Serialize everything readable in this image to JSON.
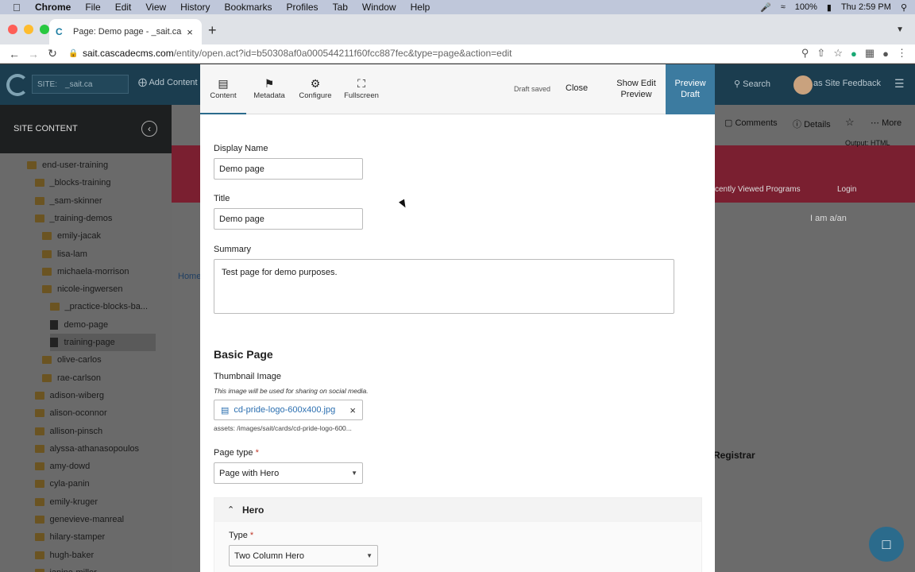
{
  "mac_menu": {
    "app": "Chrome",
    "items": [
      "File",
      "Edit",
      "View",
      "History",
      "Bookmarks",
      "Profiles",
      "Tab",
      "Window",
      "Help"
    ],
    "battery": "100%",
    "clock": "Thu 2:59 PM"
  },
  "browser": {
    "tab_title": "Page: Demo page - _sait.ca | C",
    "url_host": "sait.cascadecms.com",
    "url_path": "/entity/open.act?id=b50308af0a000544211f60fcc887fec&type=page&action=edit"
  },
  "cms": {
    "site_label": "SITE:",
    "site_value": "_sait.ca",
    "add_content": "Add Content",
    "search": "Search",
    "site_feedback": "as Site Feedback",
    "sidebar_title": "SITE CONTENT",
    "tree": [
      {
        "label": "end-user-training",
        "type": "folder",
        "indent": 1
      },
      {
        "label": "_blocks-training",
        "type": "folder",
        "indent": 2
      },
      {
        "label": "_sam-skinner",
        "type": "folder",
        "indent": 2
      },
      {
        "label": "_training-demos",
        "type": "folder",
        "indent": 2
      },
      {
        "label": "emily-jacak",
        "type": "folder",
        "indent": 3
      },
      {
        "label": "lisa-lam",
        "type": "folder",
        "indent": 3
      },
      {
        "label": "michaela-morrison",
        "type": "folder",
        "indent": 3
      },
      {
        "label": "nicole-ingwersen",
        "type": "folder",
        "indent": 3
      },
      {
        "label": "_practice-blocks-ba...",
        "type": "folder",
        "indent": 4
      },
      {
        "label": "demo-page",
        "type": "page",
        "indent": 4
      },
      {
        "label": "training-page",
        "type": "page",
        "indent": 4,
        "selected": true
      },
      {
        "label": "olive-carlos",
        "type": "folder",
        "indent": 3
      },
      {
        "label": "rae-carlson",
        "type": "folder",
        "indent": 3
      },
      {
        "label": "adison-wiberg",
        "type": "folder",
        "indent": 2
      },
      {
        "label": "alison-oconnor",
        "type": "folder",
        "indent": 2
      },
      {
        "label": "allison-pinsch",
        "type": "folder",
        "indent": 2
      },
      {
        "label": "alyssa-athanasopoulos",
        "type": "folder",
        "indent": 2
      },
      {
        "label": "amy-dowd",
        "type": "folder",
        "indent": 2
      },
      {
        "label": "cyla-panin",
        "type": "folder",
        "indent": 2
      },
      {
        "label": "emily-kruger",
        "type": "folder",
        "indent": 2
      },
      {
        "label": "genevieve-manreal",
        "type": "folder",
        "indent": 2
      },
      {
        "label": "hilary-stamper",
        "type": "folder",
        "indent": 2
      },
      {
        "label": "hugh-baker",
        "type": "folder",
        "indent": 2
      },
      {
        "label": "janine-miller",
        "type": "folder",
        "indent": 2
      }
    ],
    "bg": {
      "comments": "Comments",
      "details": "Details",
      "more": "More",
      "output": "Output: HTML",
      "recently_viewed": "cently Viewed Programs",
      "login": "Login",
      "i_am": "I am a/an",
      "home": "Home",
      "registrar": "Registrar"
    }
  },
  "editor": {
    "tabs": [
      {
        "label": "Content",
        "icon": "document-icon"
      },
      {
        "label": "Metadata",
        "icon": "tag-icon"
      },
      {
        "label": "Configure",
        "icon": "gear-icon"
      },
      {
        "label": "Fullscreen",
        "icon": "expand-icon"
      }
    ],
    "draft_saved": "Draft saved",
    "close": "Close",
    "show_preview": "Show Edit Preview",
    "preview_draft": "Preview Draft",
    "display_name_label": "Display Name",
    "display_name": "Demo page",
    "title_label": "Title",
    "title": "Demo page",
    "summary_label": "Summary",
    "summary": "Test page for demo purposes.",
    "section_heading": "Basic Page",
    "thumbnail_label": "Thumbnail Image",
    "thumbnail_hint": "This image will be used for sharing on social media.",
    "thumbnail_file": "cd-pride-logo-600x400.jpg",
    "thumbnail_path": "assets: /images/sait/cards/cd-pride-logo-600...",
    "page_type_label": "Page type",
    "page_type": "Page with Hero",
    "hero_heading": "Hero",
    "type_label": "Type",
    "type_value": "Two Column Hero"
  }
}
